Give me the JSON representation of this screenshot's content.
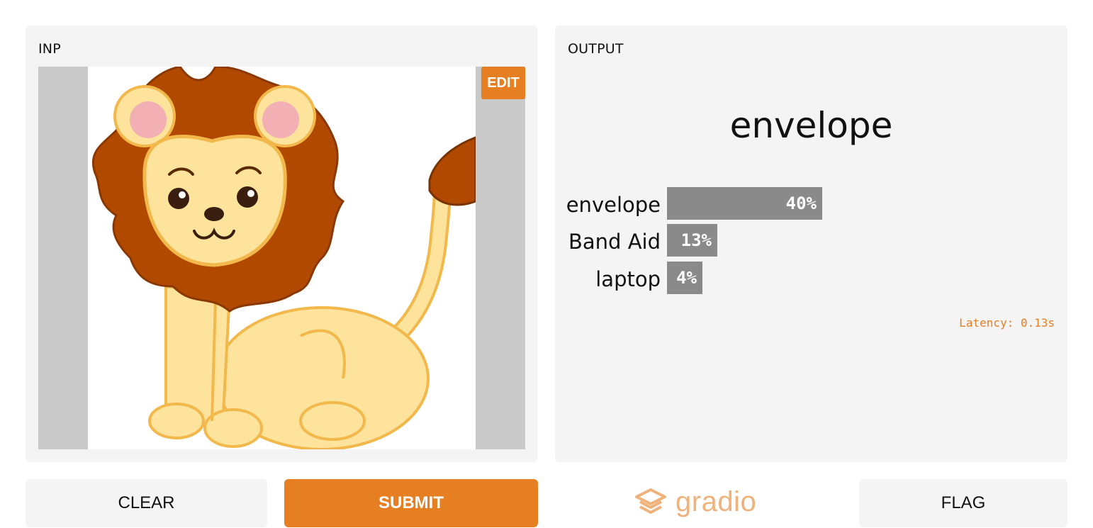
{
  "input_panel": {
    "title": "INP",
    "edit_label": "EDIT",
    "image_subject": "cartoon-lion"
  },
  "output_panel": {
    "title": "OUTPUT",
    "predicted_label": "envelope",
    "confidences": [
      {
        "label": "envelope",
        "percent_text": "40%",
        "value": 0.4
      },
      {
        "label": "Band Aid",
        "percent_text": "13%",
        "value": 0.13
      },
      {
        "label": "laptop",
        "percent_text": "4%",
        "value": 0.04
      }
    ],
    "latency": "Latency: 0.13s"
  },
  "buttons": {
    "clear": "CLEAR",
    "submit": "SUBMIT",
    "flag": "FLAG"
  },
  "branding": {
    "logo_text": "gradio",
    "logo_icon": "gradio-logo-icon"
  },
  "colors": {
    "accent": "#e67e22",
    "panel_bg": "#f4f4f4",
    "bar": "#8a8a8a",
    "logo": "#f0b27a"
  }
}
